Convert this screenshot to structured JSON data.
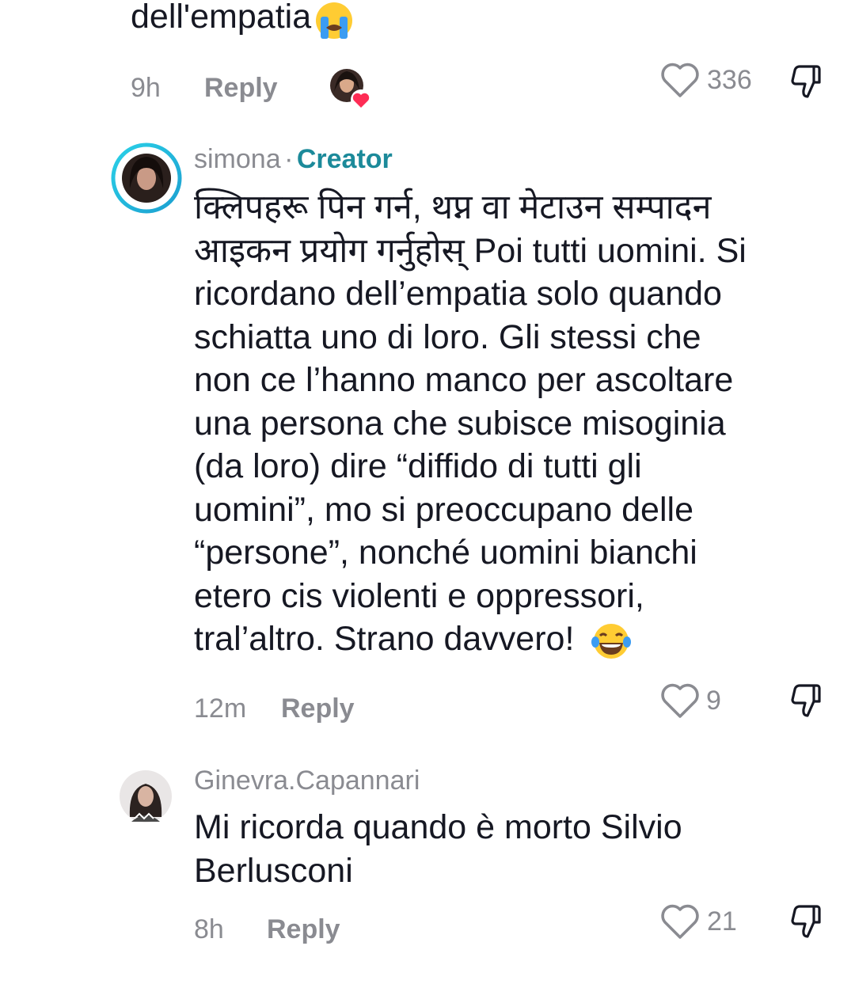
{
  "top_comment": {
    "text_tail": "dell'empatia",
    "time": "9h",
    "reply_label": "Reply",
    "likes": "336",
    "liked_by_creator": true
  },
  "comment_creator": {
    "username": "simona",
    "separator": "·",
    "badge": "Creator",
    "text": "क्लिपहरू पिन गर्न, थप्न वा मेटाउन सम्पादन आइकन प्रयोग गर्नुहोस् Poi tutti uomini. Si ricordano dell’empatia solo quando schiatta uno di loro. Gli stessi che non ce l’hanno manco per ascoltare una persona che subisce misoginia (da loro) dire “diffido di tutti gli uomini”, mo si preoccupano delle “persone”, nonché uomini bianchi etero cis violenti e oppressori, tral’altro. Strano davvero!",
    "lines": [
      "क्लिपहरू पिन गर्न, थप्न वा मेटाउन सम्पादन",
      "आइकन प्रयोग गर्नुहोस् Poi tutti uomini. Si",
      "ricordano dell’empatia solo quando",
      "schiatta uno di loro. Gli stessi che",
      "non ce l’hanno manco per ascoltare",
      "una persona che subisce misoginia",
      "(da loro) dire “diffido di tutti gli",
      "uomini”, mo si preoccupano delle",
      "“persone”, nonché uomini bianchi",
      "etero cis violenti e oppressori,",
      "tral’altro. Strano davvero!"
    ],
    "time": "12m",
    "reply_label": "Reply",
    "likes": "9"
  },
  "comment_ginevra": {
    "username": "Ginevra.Capannari",
    "lines": [
      "Mi ricorda quando è morto Silvio",
      "Berlusconi"
    ],
    "time": "8h",
    "reply_label": "Reply",
    "likes": "21"
  },
  "colors": {
    "meta_gray": "#8a8b91",
    "creator_teal": "#1c8a9a",
    "text": "#161823",
    "heart_red": "#fe2c55"
  },
  "icons": [
    "heart-outline-icon",
    "dislike-icon",
    "crying-emoji-icon",
    "laughing-emoji-icon",
    "avatar-heart-icon"
  ]
}
